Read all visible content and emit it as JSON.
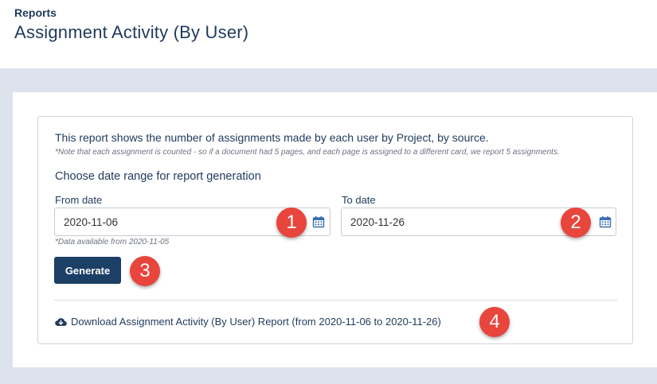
{
  "header": {
    "breadcrumb": "Reports",
    "title": "Assignment Activity (By User)"
  },
  "report": {
    "description": "This report shows the number of assignments made by each user by Project, by source.",
    "note": "*Note that each assignment is counted - so if a document had 5 pages, and each page is assigned to a different card, we report 5 assignments.",
    "subheading": "Choose date range for report generation",
    "from_label": "From date",
    "from_value": "2020-11-06",
    "to_label": "To date",
    "to_value": "2020-11-26",
    "availability": "*Data available from 2020-11-05",
    "generate_label": "Generate",
    "download_text": "Download Assignment Activity (By User) Report (from 2020-11-06 to 2020-11-26)"
  },
  "callouts": [
    "1",
    "2",
    "3",
    "4"
  ],
  "colors": {
    "primary": "#1c3f66",
    "callout": "#e8453c",
    "background": "#dde3ec"
  }
}
